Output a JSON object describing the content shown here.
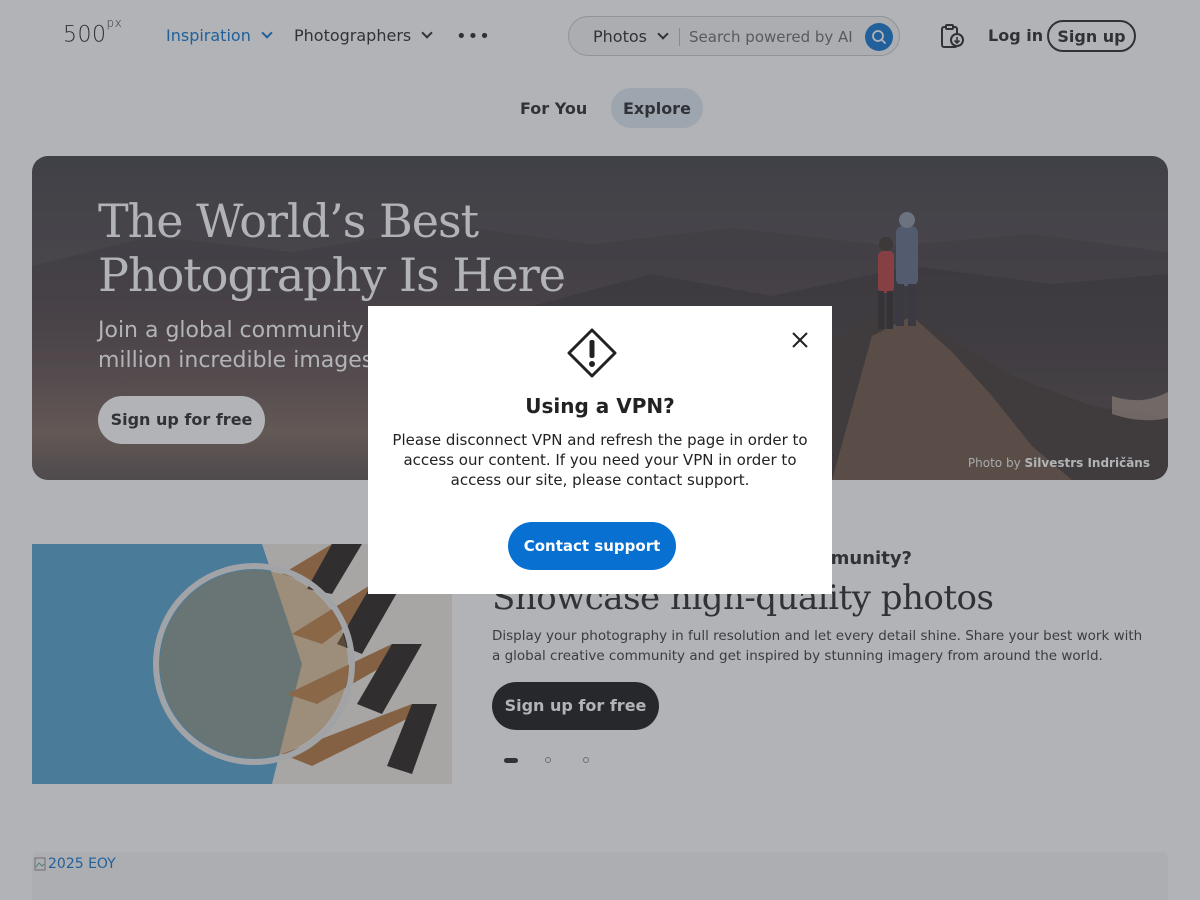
{
  "header": {
    "logo": "500",
    "logo_sup": "px",
    "nav": [
      {
        "label": "Inspiration",
        "active": true
      },
      {
        "label": "Photographers",
        "active": false
      }
    ],
    "more_label": "•••",
    "search": {
      "type_label": "Photos",
      "placeholder": "Search powered by AI"
    },
    "login_label": "Log in",
    "signup_label": "Sign up"
  },
  "tabs": [
    {
      "label": "For You",
      "active": false
    },
    {
      "label": "Explore",
      "active": true
    }
  ],
  "hero": {
    "title_line1": "The World’s Best",
    "title_line2": "Photography Is Here",
    "subtitle_line1": "Join a global community of",
    "subtitle_line2": "million incredible images o",
    "button_label": "Sign up for free",
    "credit_prefix": "Photo by",
    "credit_name": "Silvestrs Indričāns"
  },
  "showcase": {
    "question": "mmunity?",
    "title": "Showcase high-quality photos",
    "description": "Display your photography in full resolution and let every detail shine. Share your best work with a global creative community and get inspired by stunning imagery from around the world.",
    "button_label": "Sign up for free",
    "carousel_index": 1,
    "carousel_total": 3
  },
  "eoy_alt": "2025 EOY",
  "modal": {
    "title": "Using a VPN?",
    "body": "Please disconnect VPN and refresh the page in order to access our content. If you need your VPN in order to access our site, please contact support.",
    "button_label": "Contact support"
  },
  "colors": {
    "accent": "#0870d1",
    "overlay": "rgba(70,74,80,0.42)",
    "tab_active_bg": "#dde8f2"
  }
}
